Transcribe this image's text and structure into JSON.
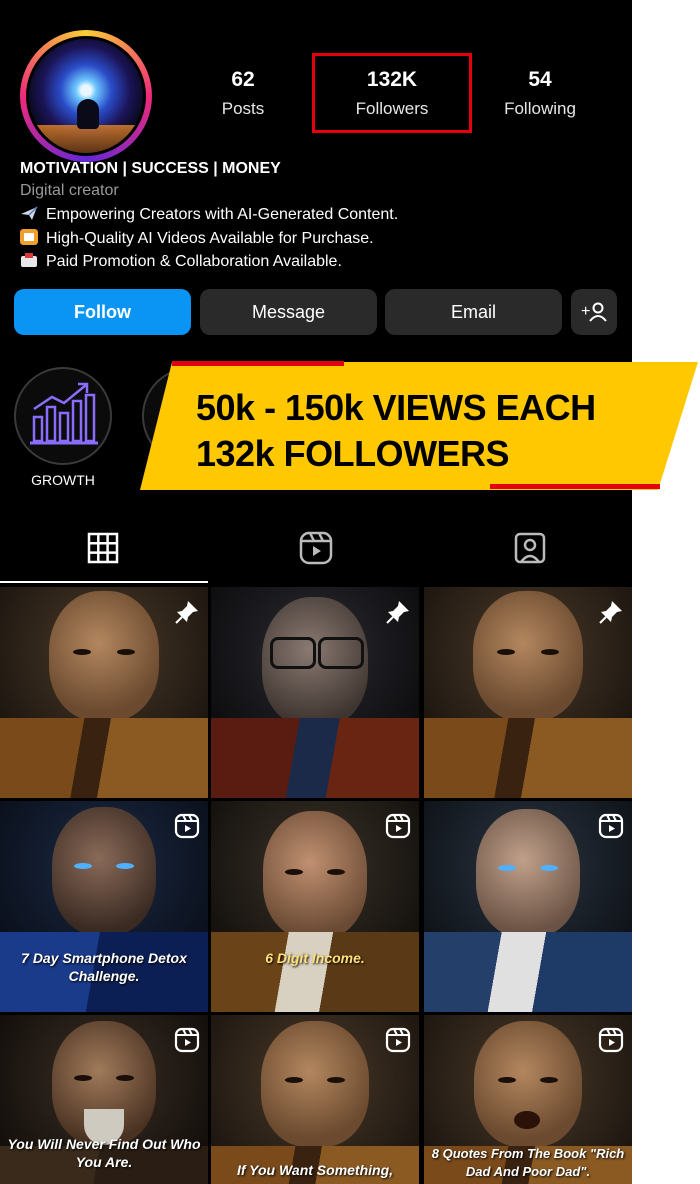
{
  "profile": {
    "name": "MOTIVATION | SUCCESS | MONEY",
    "category": "Digital creator",
    "bio": [
      "Empowering Creators with AI-Generated Content.",
      "High-Quality AI Videos Available for Purchase.",
      "Paid Promotion & Collaboration Available."
    ],
    "bio_icons": [
      "airplane-emoji-icon",
      "film-emoji-icon",
      "inbox-emoji-icon"
    ]
  },
  "stats": {
    "posts": {
      "value": "62",
      "label": "Posts"
    },
    "followers": {
      "value": "132K",
      "label": "Followers"
    },
    "following": {
      "value": "54",
      "label": "Following"
    }
  },
  "actions": {
    "follow": "Follow",
    "message": "Message",
    "email": "Email"
  },
  "highlights": [
    {
      "label": "GROWTH",
      "icon": "bar-chart-growth-icon"
    }
  ],
  "banner": {
    "line1": "50k - 150k VIEWS EACH",
    "line2": "132k FOLLOWERS"
  },
  "tabs": [
    "grid-icon",
    "reels-icon",
    "tagged-icon"
  ],
  "posts": [
    {
      "caption": "",
      "icon": "pin-icon"
    },
    {
      "caption": "",
      "icon": "pin-icon"
    },
    {
      "caption": "",
      "icon": "pin-icon"
    },
    {
      "caption": "7 Day Smartphone Detox Challenge.",
      "icon": "reel-icon"
    },
    {
      "caption": "6 Digit Income.",
      "icon": "reel-icon"
    },
    {
      "caption": "",
      "icon": "reel-icon"
    },
    {
      "caption": "You Will Never Find Out Who You Are.",
      "icon": "reel-icon"
    },
    {
      "caption": "If You Want Something,",
      "icon": "reel-icon"
    },
    {
      "caption": "8 Quotes From The Book \"Rich Dad And Poor Dad\".",
      "icon": "reel-icon"
    }
  ],
  "colors": {
    "follow_button": "#0a95f5",
    "banner": "#ffc800",
    "highlight_box": "#e3000f"
  }
}
